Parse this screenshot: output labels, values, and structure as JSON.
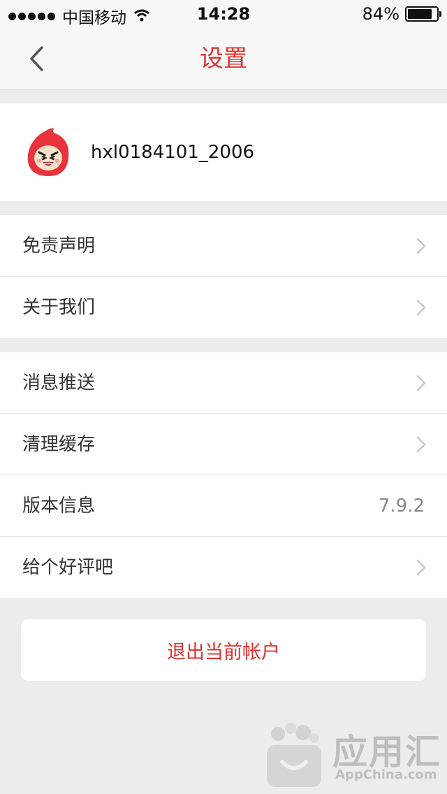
{
  "status_bar": {
    "carrier": "中国移动",
    "time": "14:28",
    "battery_text": "84%",
    "battery_level": 0.84
  },
  "nav": {
    "title": "设置",
    "back_icon": "chevron-left-icon"
  },
  "profile": {
    "username": "hxl0184101_2006",
    "avatar_icon": "red-hood-mascot-avatar"
  },
  "group1": [
    {
      "label": "免责声明"
    },
    {
      "label": "关于我们"
    }
  ],
  "group2": [
    {
      "label": "消息推送"
    },
    {
      "label": "清理缓存"
    },
    {
      "label": "版本信息",
      "value": "7.9.2"
    },
    {
      "label": "给个好评吧"
    }
  ],
  "logout": {
    "label": "退出当前帐户"
  },
  "watermark": {
    "text": "应用汇",
    "sub": "AppChina.com"
  },
  "colors": {
    "accent": "#e0332f",
    "background": "#ececec",
    "card": "#ffffff"
  }
}
